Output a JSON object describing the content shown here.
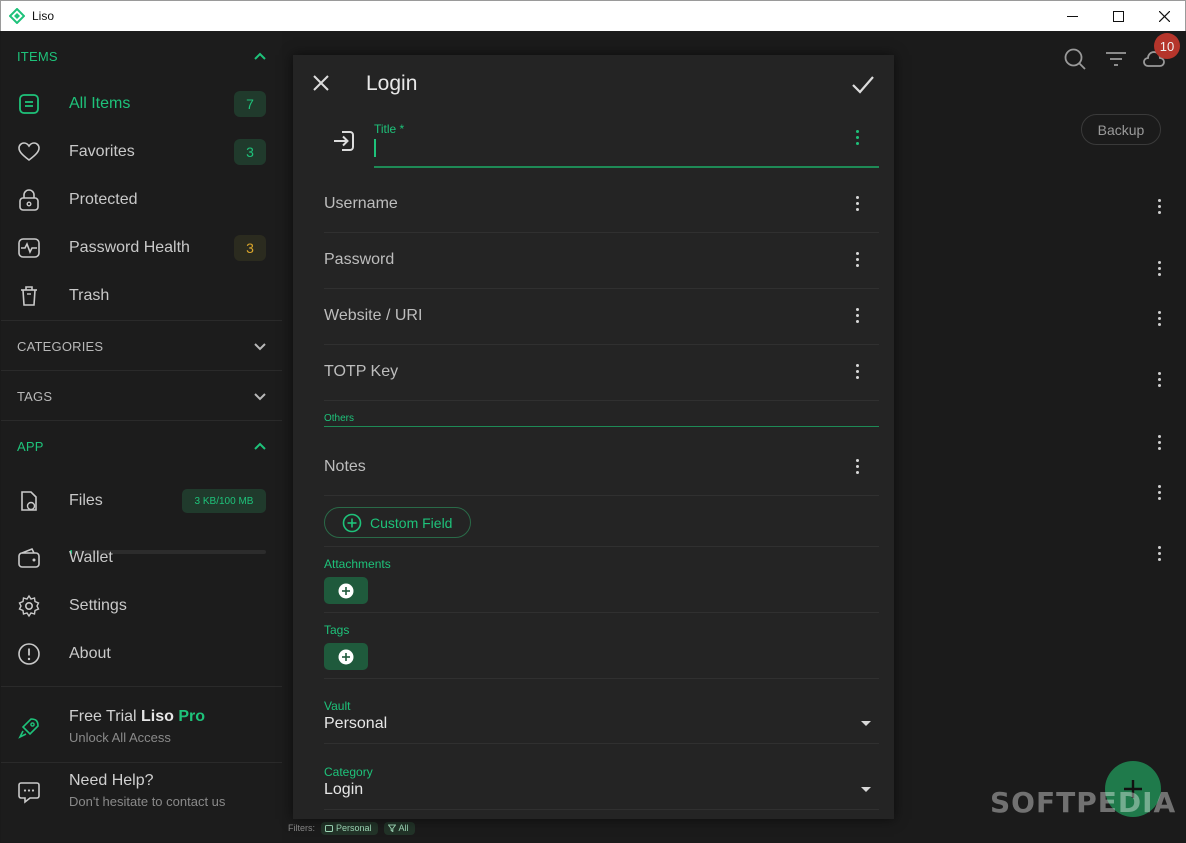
{
  "window": {
    "title": "Liso"
  },
  "colors": {
    "accent": "#1ec27a",
    "warning": "#d9a52b",
    "notification": "#b5352b",
    "background": "#1b1b1b",
    "dialog": "#242424"
  },
  "sidebar": {
    "items_header": "ITEMS",
    "items": [
      {
        "label": "All Items",
        "icon": "list-icon",
        "badge": "7",
        "selected": true
      },
      {
        "label": "Favorites",
        "icon": "heart-icon",
        "badge": "3"
      },
      {
        "label": "Protected",
        "icon": "lock-icon"
      },
      {
        "label": "Password Health",
        "icon": "health-icon",
        "badge": "3",
        "badge_state": "warning"
      },
      {
        "label": "Trash",
        "icon": "trash-icon"
      }
    ],
    "categories_header": "CATEGORIES",
    "tags_header": "TAGS",
    "app_header": "APP",
    "app_items": [
      {
        "label": "Files",
        "icon": "file-icon",
        "storage": "3 KB/100 MB",
        "storage_used_fraction": 0.0
      },
      {
        "label": "Wallet",
        "icon": "wallet-icon"
      },
      {
        "label": "Settings",
        "icon": "gear-icon"
      },
      {
        "label": "About",
        "icon": "info-icon"
      }
    ],
    "promo": {
      "prefix": "Free Trial ",
      "brand": "Liso",
      "pro": " Pro",
      "subtitle": "Unlock All Access"
    },
    "help": {
      "title": "Need Help?",
      "subtitle": "Don't hesitate to contact us"
    }
  },
  "main": {
    "notification_count": "10",
    "backup_label": "Backup",
    "filters": {
      "label": "Filters:",
      "vault": "Personal",
      "type": "All"
    }
  },
  "dialog": {
    "title": "Login",
    "title_field": {
      "label": "Title *",
      "value": ""
    },
    "fields": [
      "Username",
      "Password",
      "Website / URI",
      "TOTP Key"
    ],
    "others_label": "Others",
    "notes_label": "Notes",
    "custom_field_label": "Custom Field",
    "attachments_label": "Attachments",
    "tags_label": "Tags",
    "vault": {
      "label": "Vault",
      "value": "Personal"
    },
    "category": {
      "label": "Category",
      "value": "Login"
    }
  },
  "watermark": "SOFTPEDIA"
}
